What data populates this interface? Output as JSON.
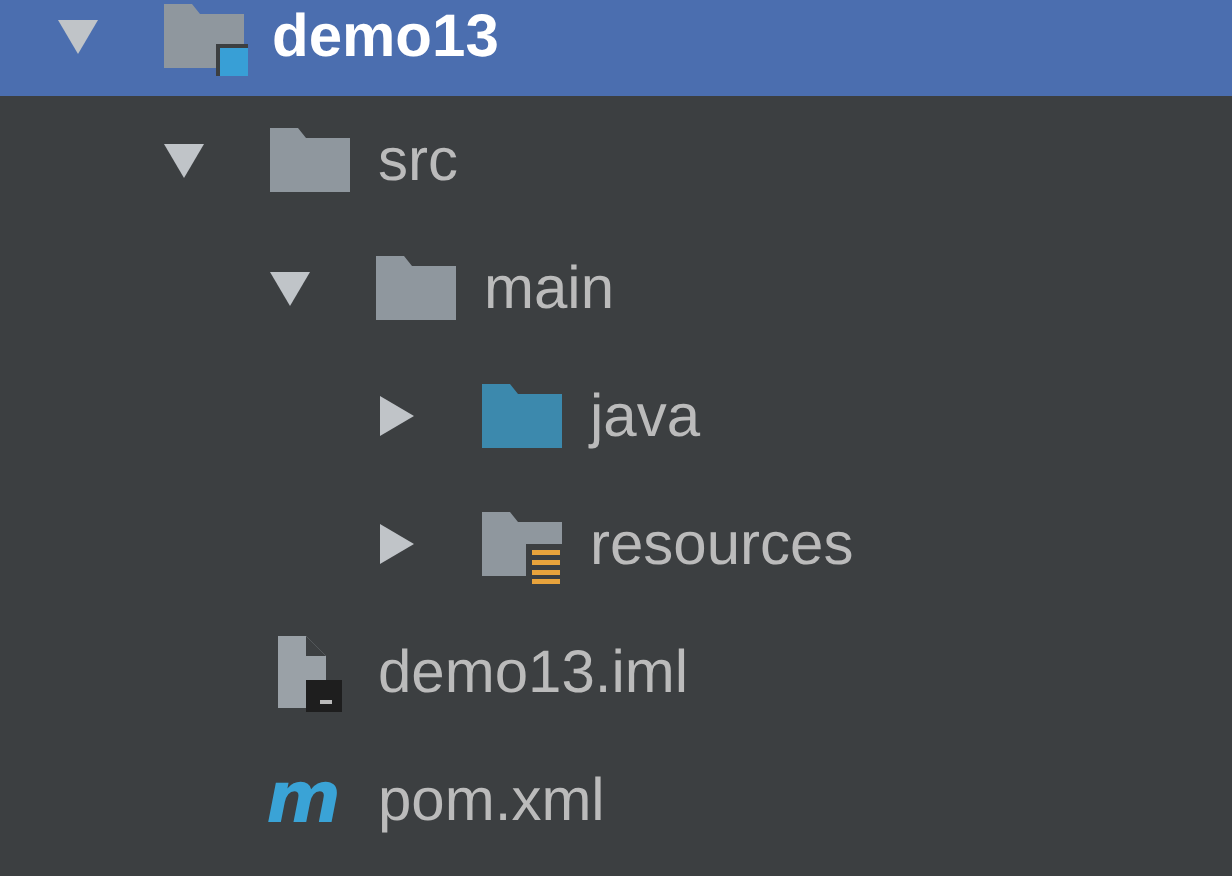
{
  "tree": [
    {
      "label": "demo13",
      "kind": "module",
      "expanded": true,
      "selected": true,
      "children": [
        {
          "label": "src",
          "kind": "folder",
          "expanded": true,
          "selected": false,
          "children": [
            {
              "label": "main",
              "kind": "folder",
              "expanded": true,
              "selected": false,
              "children": [
                {
                  "label": "java",
                  "kind": "source_folder",
                  "expanded": false,
                  "selected": false
                },
                {
                  "label": "resources",
                  "kind": "resources_folder",
                  "expanded": false,
                  "selected": false
                }
              ]
            }
          ]
        },
        {
          "label": "demo13.iml",
          "kind": "iml_file",
          "selected": false
        },
        {
          "label": "pom.xml",
          "kind": "maven_file",
          "icon_glyph": "m",
          "selected": false
        }
      ]
    }
  ]
}
